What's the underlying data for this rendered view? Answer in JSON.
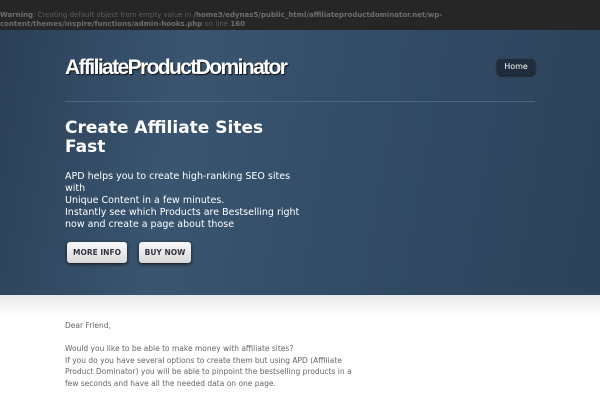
{
  "warning": {
    "label": "Warning",
    "message": ": Creating default object from empty value in ",
    "path": "/home3/edynas5/public_html/affiliateproductdominator.net/wp-content/themes/inspire/functions/admin-hooks.php",
    "line_prefix": " on line ",
    "line": "160"
  },
  "header": {
    "logo": "AffiliateProductDominator",
    "nav_home": "Home"
  },
  "hero": {
    "title": "Create Affiliate Sites Fast",
    "lines": [
      "APD helps you to create high-ranking SEO sites with",
      "Unique Content in a few minutes.",
      "Instantly see which Products are Bestselling right now and create a page about those"
    ],
    "more_info": "MORE INFO",
    "buy_now": "BUY NOW"
  },
  "content": {
    "greeting": "Dear Friend,",
    "lines": [
      "Would you like to be able to make money with affiliate sites?",
      "If you do you have several options to create them but using APD (Affiliate Product Dominator) you will be able to pinpoint the bestselling products in a few seconds and have all the needed data on one page."
    ]
  }
}
